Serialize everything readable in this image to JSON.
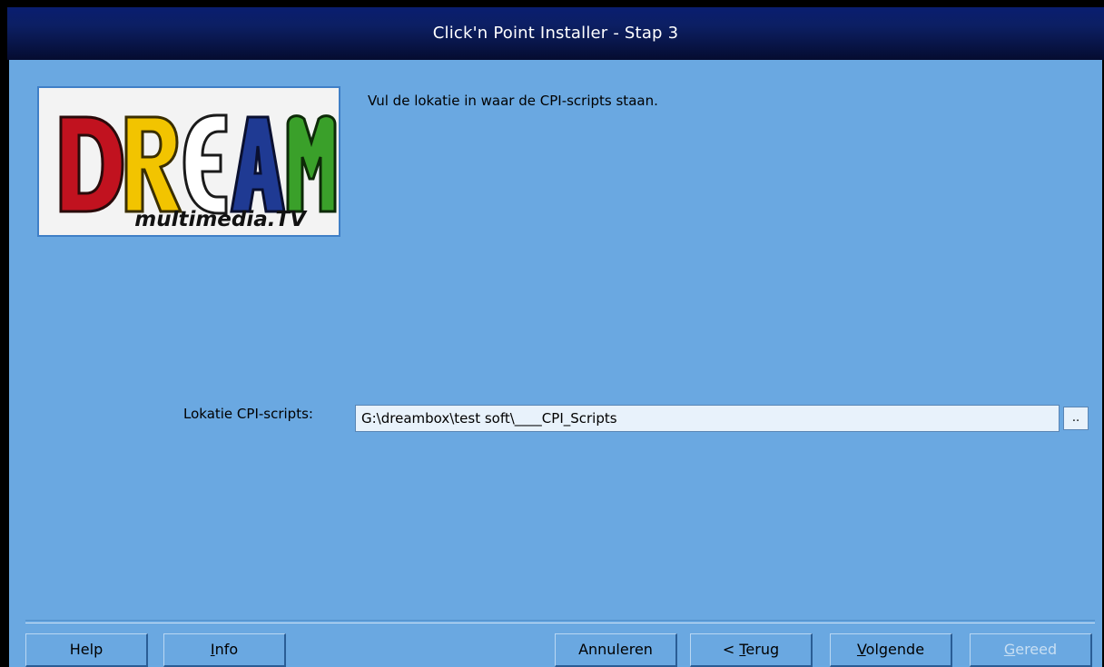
{
  "window": {
    "title": "Click'n Point Installer - Stap 3"
  },
  "logo": {
    "main_text": "DREAM",
    "sub_text": "multimedia.TV"
  },
  "instruction": "Vul de lokatie in waar de CPI-scripts staan.",
  "field": {
    "label": "Lokatie CPI-scripts:",
    "value": "G:\\dreambox\\test soft\\____CPI_Scripts",
    "browse_label": ".."
  },
  "buttons": {
    "help": "Help",
    "info": {
      "mnemonic": "I",
      "rest": "nfo"
    },
    "cancel": "Annuleren",
    "back": {
      "prefix": "< ",
      "mnemonic": "T",
      "rest": "erug"
    },
    "next": {
      "mnemonic": "V",
      "rest": "olgende"
    },
    "finish": {
      "mnemonic": "G",
      "rest": "ereed"
    }
  },
  "colors": {
    "client_bg": "#6aa8e1",
    "titlebar": "#0c1f63",
    "logo_d": "#c1121f",
    "logo_r": "#f2c400",
    "logo_e": "#ffffff",
    "logo_a": "#1f3a93",
    "logo_m": "#3aa02a"
  }
}
